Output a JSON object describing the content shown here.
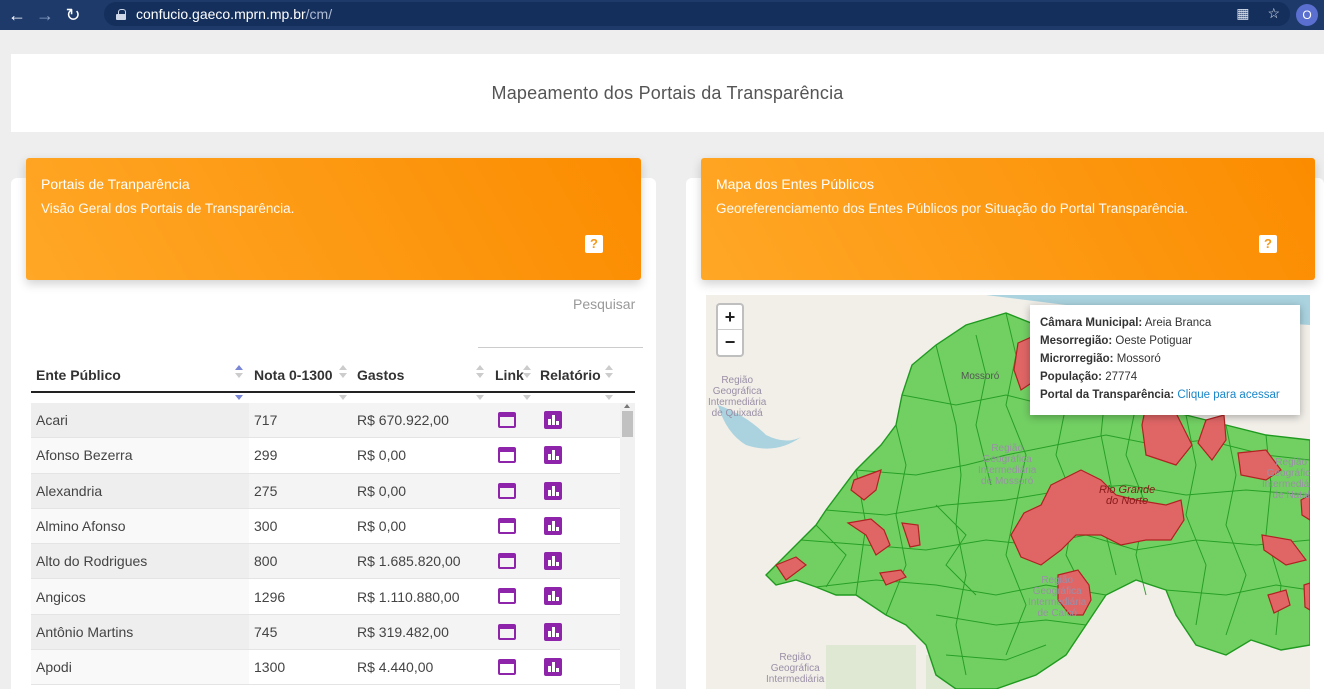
{
  "browser": {
    "url_host": "confucio.gaeco.mprn.mp.br",
    "url_path": "/cm/",
    "avatar_letter": "O"
  },
  "header": {
    "title": "Mapeamento dos Portais da Transparência"
  },
  "left_panel": {
    "title": "Portais de Tranparência",
    "subtitle": "Visão Geral dos Portais de Transparência.",
    "help_label": "?",
    "search_label": "Pesquisar",
    "columns": [
      "Ente Público",
      "Nota 0-1300",
      "Gastos",
      "Link",
      "Relatório"
    ],
    "rows": [
      {
        "ente": "Acari",
        "nota": "717",
        "gastos": "R$ 670.922,00"
      },
      {
        "ente": "Afonso Bezerra",
        "nota": "299",
        "gastos": "R$ 0,00"
      },
      {
        "ente": "Alexandria",
        "nota": "275",
        "gastos": "R$ 0,00"
      },
      {
        "ente": "Almino Afonso",
        "nota": "300",
        "gastos": "R$ 0,00"
      },
      {
        "ente": "Alto do Rodrigues",
        "nota": "800",
        "gastos": "R$ 1.685.820,00"
      },
      {
        "ente": "Angicos",
        "nota": "1296",
        "gastos": "R$ 1.110.880,00"
      },
      {
        "ente": "Antônio Martins",
        "nota": "745",
        "gastos": "R$ 319.482,00"
      },
      {
        "ente": "Apodi",
        "nota": "1300",
        "gastos": "R$ 4.440,00"
      }
    ]
  },
  "right_panel": {
    "title": "Mapa dos Entes Públicos",
    "subtitle": "Georeferenciamento dos Entes Públicos por Situação do Portal Transparência.",
    "help_label": "?",
    "zoom_in": "+",
    "zoom_out": "−",
    "popup": {
      "camara_label": "Câmara Municipal:",
      "camara_value": "Areia Branca",
      "meso_label": "Mesorregião:",
      "meso_value": "Oeste Potiguar",
      "micro_label": "Microrregião:",
      "micro_value": "Mossoró",
      "pop_label": "População:",
      "pop_value": "27774",
      "portal_label": "Portal da Transparência:",
      "portal_link": "Clique para acessar"
    },
    "map_labels": {
      "quixada": "Região\nGeográfica\nIntermediária\nde Quixadá",
      "mossoro_city": "Mossoró",
      "mossoro_region": "Região\nGeográfica\nIntermediária\nde Mossoró",
      "rio_grande": "Rio Grande\ndo Norte",
      "caico": "Região\nGeográfica\nIntermediária\nde Caicó",
      "natal": "Região\nGeográfica\nIntermediária\nde Natal",
      "bottom": "Região\nGeográfica\nIntermediária"
    },
    "colors": {
      "ok": "#6fcf61",
      "bad": "#e05a5a",
      "border": "#1f9a1f"
    }
  }
}
